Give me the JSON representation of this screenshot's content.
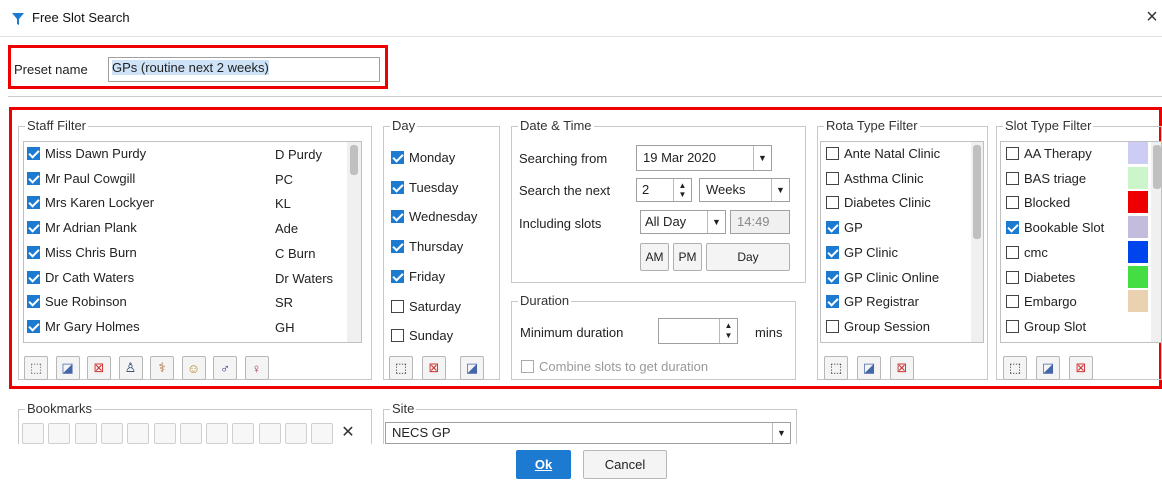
{
  "window": {
    "title": "Free Slot Search",
    "close_glyph": "×"
  },
  "preset": {
    "label": "Preset name",
    "value": "GPs (routine next 2 weeks)"
  },
  "staff_filter": {
    "legend": "Staff Filter",
    "staff": [
      {
        "name": "Miss Dawn Purdy",
        "short": "D Purdy",
        "checked": true
      },
      {
        "name": "Mr Paul Cowgill",
        "short": "PC",
        "checked": true
      },
      {
        "name": "Mrs Karen Lockyer",
        "short": "KL",
        "checked": true
      },
      {
        "name": "Mr Adrian Plank",
        "short": "Ade",
        "checked": true
      },
      {
        "name": "Miss Chris Burn",
        "short": "C Burn",
        "checked": true
      },
      {
        "name": "Dr Cath Waters",
        "short": "Dr Waters",
        "checked": true
      },
      {
        "name": "Sue Robinson",
        "short": "SR",
        "checked": true
      },
      {
        "name": "Mr Gary Holmes",
        "short": "GH",
        "checked": true
      }
    ],
    "buttons": [
      {
        "icon": "select-none-icon",
        "glyph": "⬚"
      },
      {
        "icon": "select-all-icon",
        "glyph": "◪"
      },
      {
        "icon": "invert-selection-icon",
        "glyph": "⊠"
      },
      {
        "icon": "doctor-icon",
        "glyph": "♙"
      },
      {
        "icon": "nurse-icon",
        "glyph": "⚕"
      },
      {
        "icon": "staff-group-icon",
        "glyph": "☺"
      },
      {
        "icon": "male-icon",
        "glyph": "♂"
      },
      {
        "icon": "female-icon",
        "glyph": "♀"
      }
    ]
  },
  "day": {
    "legend": "Day",
    "days": [
      {
        "label": "Monday",
        "checked": true
      },
      {
        "label": "Tuesday",
        "checked": true
      },
      {
        "label": "Wednesday",
        "checked": true
      },
      {
        "label": "Thursday",
        "checked": true
      },
      {
        "label": "Friday",
        "checked": true
      },
      {
        "label": "Saturday",
        "checked": false
      },
      {
        "label": "Sunday",
        "checked": false
      }
    ]
  },
  "date_time": {
    "legend": "Date & Time",
    "searching_from_label": "Searching from",
    "searching_from_value": "19 Mar 2020",
    "search_next_label": "Search the next",
    "search_next_value": "2",
    "search_next_unit": "Weeks",
    "including_slots_label": "Including slots",
    "including_slots_value": "All Day",
    "time_value": "14:49",
    "am_label": "AM",
    "pm_label": "PM",
    "day_label": "Day"
  },
  "duration": {
    "legend": "Duration",
    "min_duration_label": "Minimum duration",
    "min_duration_value": "",
    "mins_label": "mins",
    "combine_label": "Combine slots to get duration",
    "combine_checked": false
  },
  "rota_filter": {
    "legend": "Rota Type Filter",
    "items": [
      {
        "label": "Ante Natal Clinic",
        "checked": false
      },
      {
        "label": "Asthma Clinic",
        "checked": false
      },
      {
        "label": "Diabetes Clinic",
        "checked": false
      },
      {
        "label": "GP",
        "checked": true
      },
      {
        "label": "GP Clinic",
        "checked": true
      },
      {
        "label": "GP Clinic Online",
        "checked": true
      },
      {
        "label": "GP Registrar",
        "checked": true
      },
      {
        "label": "Group Session",
        "checked": false
      }
    ]
  },
  "slot_filter": {
    "legend": "Slot Type Filter",
    "items": [
      {
        "label": "AA Therapy",
        "checked": false,
        "color": "#ccccf5"
      },
      {
        "label": "BAS triage",
        "checked": false,
        "color": "#ccf5cc"
      },
      {
        "label": "Blocked",
        "checked": false,
        "color": "#ee0000"
      },
      {
        "label": "Bookable Slot",
        "checked": true,
        "color": "#c4bcdc"
      },
      {
        "label": "cmc",
        "checked": false,
        "color": "#0044ee"
      },
      {
        "label": "Diabetes",
        "checked": false,
        "color": "#44dd44"
      },
      {
        "label": "Embargo",
        "checked": false,
        "color": "#ead2b0"
      },
      {
        "label": "Group Slot",
        "checked": false,
        "color": "#ffffff"
      }
    ]
  },
  "bookmarks": {
    "legend": "Bookmarks",
    "clear_glyph": "✕"
  },
  "site": {
    "legend": "Site",
    "value": "NECS GP"
  },
  "footer": {
    "ok_label": "Ok",
    "cancel_label": "Cancel"
  },
  "colors": {
    "highlight": "#e00000",
    "accent": "#1c7bd1"
  }
}
